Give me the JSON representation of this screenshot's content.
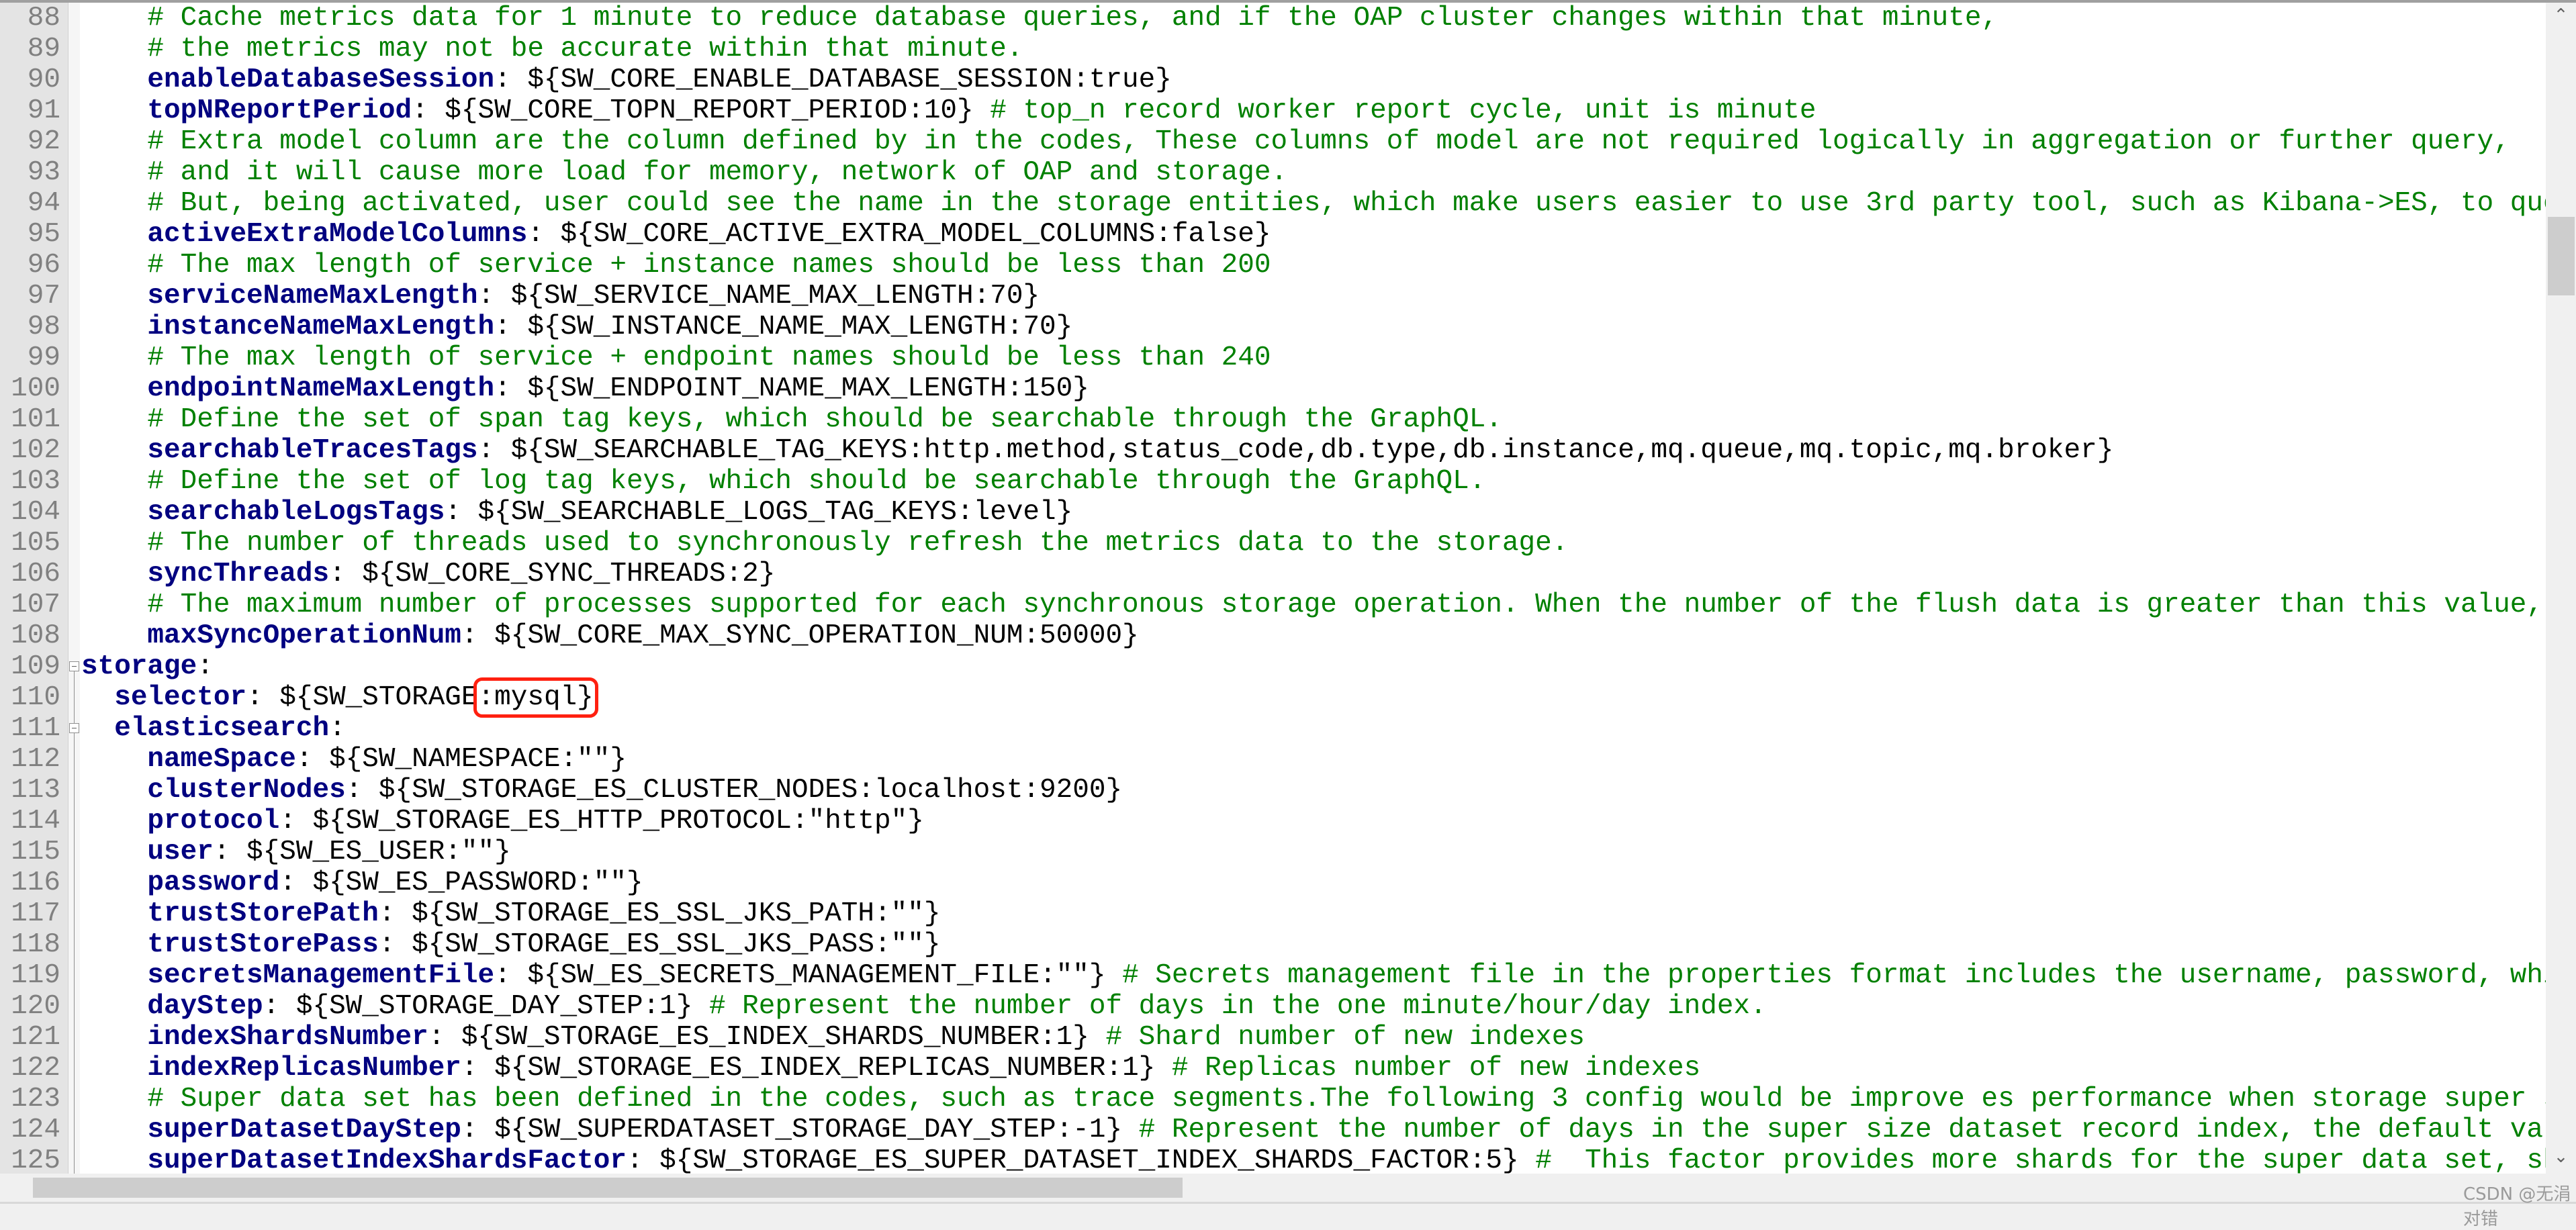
{
  "editor": {
    "colors": {
      "key": "#000080",
      "comment": "#008000",
      "value": "#000000",
      "line_number": "#808080",
      "highlight_box": "#ff2010"
    },
    "fold_markers": [
      109,
      111
    ],
    "highlighted_line": 110,
    "lines": [
      {
        "n": "88",
        "indent": 4,
        "comment": "# Cache metrics data for 1 minute to reduce database queries, and if the OAP cluster changes within that minute,"
      },
      {
        "n": "89",
        "indent": 4,
        "comment": "# the metrics may not be accurate within that minute."
      },
      {
        "n": "90",
        "indent": 4,
        "key": "enableDatabaseSession",
        "value": ": ${SW_CORE_ENABLE_DATABASE_SESSION:true}"
      },
      {
        "n": "91",
        "indent": 4,
        "key": "topNReportPeriod",
        "value": ": ${SW_CORE_TOPN_REPORT_PERIOD:10} ",
        "comment": "# top_n record worker report cycle, unit is minute"
      },
      {
        "n": "92",
        "indent": 4,
        "comment": "# Extra model column are the column defined by in the codes, These columns of model are not required logically in aggregation or further query,"
      },
      {
        "n": "93",
        "indent": 4,
        "comment": "# and it will cause more load for memory, network of OAP and storage."
      },
      {
        "n": "94",
        "indent": 4,
        "comment": "# But, being activated, user could see the name in the storage entities, which make users easier to use 3rd party tool, such as Kibana->ES, to query"
      },
      {
        "n": "95",
        "indent": 4,
        "key": "activeExtraModelColumns",
        "value": ": ${SW_CORE_ACTIVE_EXTRA_MODEL_COLUMNS:false}"
      },
      {
        "n": "96",
        "indent": 4,
        "comment": "# The max length of service + instance names should be less than 200"
      },
      {
        "n": "97",
        "indent": 4,
        "key": "serviceNameMaxLength",
        "value": ": ${SW_SERVICE_NAME_MAX_LENGTH:70}"
      },
      {
        "n": "98",
        "indent": 4,
        "key": "instanceNameMaxLength",
        "value": ": ${SW_INSTANCE_NAME_MAX_LENGTH:70}"
      },
      {
        "n": "99",
        "indent": 4,
        "comment": "# The max length of service + endpoint names should be less than 240"
      },
      {
        "n": "100",
        "indent": 4,
        "key": "endpointNameMaxLength",
        "value": ": ${SW_ENDPOINT_NAME_MAX_LENGTH:150}"
      },
      {
        "n": "101",
        "indent": 4,
        "comment": "# Define the set of span tag keys, which should be searchable through the GraphQL."
      },
      {
        "n": "102",
        "indent": 4,
        "key": "searchableTracesTags",
        "value": ": ${SW_SEARCHABLE_TAG_KEYS:http.method,status_code,db.type,db.instance,mq.queue,mq.topic,mq.broker}"
      },
      {
        "n": "103",
        "indent": 4,
        "comment": "# Define the set of log tag keys, which should be searchable through the GraphQL."
      },
      {
        "n": "104",
        "indent": 4,
        "key": "searchableLogsTags",
        "value": ": ${SW_SEARCHABLE_LOGS_TAG_KEYS:level}"
      },
      {
        "n": "105",
        "indent": 4,
        "comment": "# The number of threads used to synchronously refresh the metrics data to the storage."
      },
      {
        "n": "106",
        "indent": 4,
        "key": "syncThreads",
        "value": ": ${SW_CORE_SYNC_THREADS:2}"
      },
      {
        "n": "107",
        "indent": 4,
        "comment": "# The maximum number of processes supported for each synchronous storage operation. When the number of the flush data is greater than this value, it"
      },
      {
        "n": "108",
        "indent": 4,
        "key": "maxSyncOperationNum",
        "value": ": ${SW_CORE_MAX_SYNC_OPERATION_NUM:50000}"
      },
      {
        "n": "109",
        "indent": 0,
        "key": "storage",
        "value": ":"
      },
      {
        "n": "110",
        "indent": 2,
        "key": "selector",
        "value": ": ${SW_STORAGE",
        "highlight": ":mysql}"
      },
      {
        "n": "111",
        "indent": 2,
        "key": "elasticsearch",
        "value": ":"
      },
      {
        "n": "112",
        "indent": 4,
        "key": "nameSpace",
        "value": ": ${SW_NAMESPACE:\"\"}"
      },
      {
        "n": "113",
        "indent": 4,
        "key": "clusterNodes",
        "value": ": ${SW_STORAGE_ES_CLUSTER_NODES:localhost:9200}"
      },
      {
        "n": "114",
        "indent": 4,
        "key": "protocol",
        "value": ": ${SW_STORAGE_ES_HTTP_PROTOCOL:\"http\"}"
      },
      {
        "n": "115",
        "indent": 4,
        "key": "user",
        "value": ": ${SW_ES_USER:\"\"}"
      },
      {
        "n": "116",
        "indent": 4,
        "key": "password",
        "value": ": ${SW_ES_PASSWORD:\"\"}"
      },
      {
        "n": "117",
        "indent": 4,
        "key": "trustStorePath",
        "value": ": ${SW_STORAGE_ES_SSL_JKS_PATH:\"\"}"
      },
      {
        "n": "118",
        "indent": 4,
        "key": "trustStorePass",
        "value": ": ${SW_STORAGE_ES_SSL_JKS_PASS:\"\"}"
      },
      {
        "n": "119",
        "indent": 4,
        "key": "secretsManagementFile",
        "value": ": ${SW_ES_SECRETS_MANAGEMENT_FILE:\"\"} ",
        "comment": "# Secrets management file in the properties format includes the username, password, which"
      },
      {
        "n": "120",
        "indent": 4,
        "key": "dayStep",
        "value": ": ${SW_STORAGE_DAY_STEP:1} ",
        "comment": "# Represent the number of days in the one minute/hour/day index."
      },
      {
        "n": "121",
        "indent": 4,
        "key": "indexShardsNumber",
        "value": ": ${SW_STORAGE_ES_INDEX_SHARDS_NUMBER:1} ",
        "comment": "# Shard number of new indexes"
      },
      {
        "n": "122",
        "indent": 4,
        "key": "indexReplicasNumber",
        "value": ": ${SW_STORAGE_ES_INDEX_REPLICAS_NUMBER:1} ",
        "comment": "# Replicas number of new indexes"
      },
      {
        "n": "123",
        "indent": 4,
        "comment": "# Super data set has been defined in the codes, such as trace segments.The following 3 config would be improve es performance when storage super size"
      },
      {
        "n": "124",
        "indent": 4,
        "key": "superDatasetDayStep",
        "value": ": ${SW_SUPERDATASET_STORAGE_DAY_STEP:-1} ",
        "comment": "# Represent the number of days in the super size dataset record index, the default value"
      },
      {
        "n": "125",
        "indent": 4,
        "key": "superDatasetIndexShardsFactor",
        "value": ": ${SW_STORAGE_ES_SUPER_DATASET_INDEX_SHARDS_FACTOR:5} ",
        "comment": "#  This factor provides more shards for the super data set, shard"
      }
    ]
  },
  "scrollbars": {
    "up_icon": "chevron-up-icon",
    "down_icon": "chevron-down-icon"
  },
  "watermark": "CSDN @无涓对错"
}
